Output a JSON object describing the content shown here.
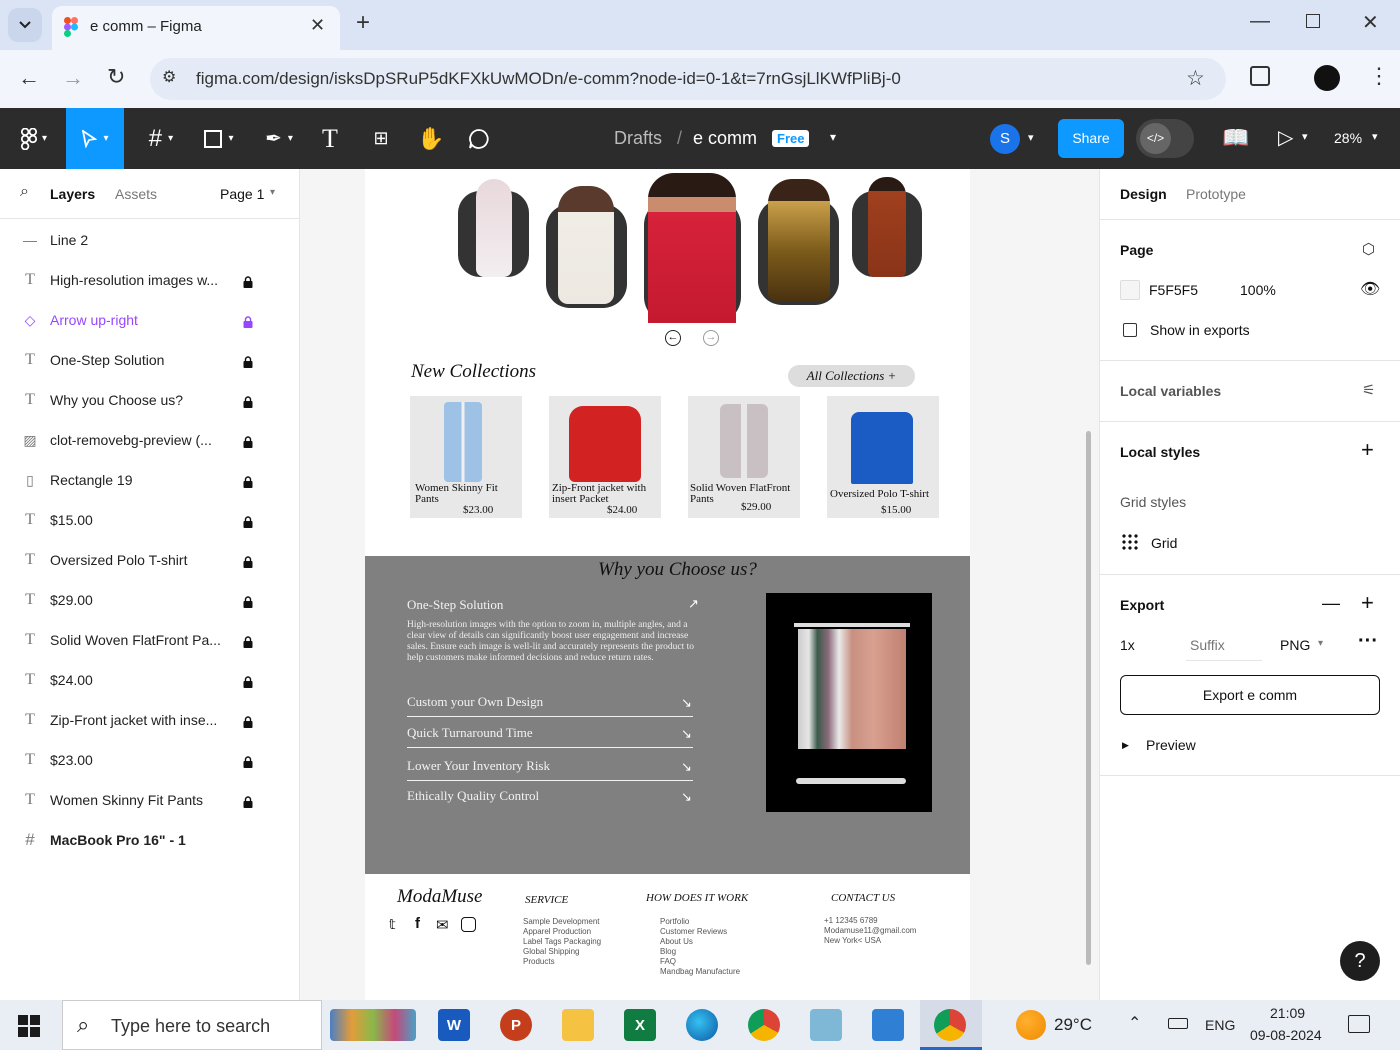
{
  "browser": {
    "tab_title": "e comm – Figma",
    "url": "figma.com/design/isksDpSRuP5dKFXkUwMODn/e-comm?node-id=0-1&t=7rnGsjLlKWfPliBj-0"
  },
  "figma_toolbar": {
    "breadcrumb_drafts": "Drafts",
    "breadcrumb_sep": "/",
    "file_name": "e comm",
    "plan_badge": "Free",
    "user_initial": "S",
    "share_label": "Share",
    "zoom": "28%"
  },
  "left_panel": {
    "tab_layers": "Layers",
    "tab_assets": "Assets",
    "page_selector": "Page 1",
    "layers": [
      {
        "name": "Line 2",
        "icon": "line-icon",
        "locked": false
      },
      {
        "name": "High-resolution images w...",
        "icon": "text-icon",
        "locked": true
      },
      {
        "name": "Arrow up-right",
        "icon": "component-icon",
        "locked": true,
        "highlight": true
      },
      {
        "name": "One-Step Solution",
        "icon": "text-icon",
        "locked": true
      },
      {
        "name": "Why you Choose us?",
        "icon": "text-icon",
        "locked": true
      },
      {
        "name": "clot-removebg-preview (...",
        "icon": "image-icon",
        "locked": true
      },
      {
        "name": "Rectangle 19",
        "icon": "rectangle-icon",
        "locked": true
      },
      {
        "name": "$15.00",
        "icon": "text-icon",
        "locked": true
      },
      {
        "name": "Oversized Polo T-shirt",
        "icon": "text-icon",
        "locked": true
      },
      {
        "name": "$29.00",
        "icon": "text-icon",
        "locked": true
      },
      {
        "name": "Solid Woven FlatFront Pa...",
        "icon": "text-icon",
        "locked": true
      },
      {
        "name": "$24.00",
        "icon": "text-icon",
        "locked": true
      },
      {
        "name": "Zip-Front jacket with inse...",
        "icon": "text-icon",
        "locked": true
      },
      {
        "name": "$23.00",
        "icon": "text-icon",
        "locked": true
      },
      {
        "name": "Women Skinny Fit Pants",
        "icon": "text-icon",
        "locked": true
      },
      {
        "name": "MacBook Pro 16\" - 1",
        "icon": "frame-icon",
        "locked": false,
        "bold": true
      }
    ]
  },
  "design": {
    "new_collections_title": "New Collections",
    "all_collections_btn": "All Collections +",
    "products": [
      {
        "name": "Women Skinny Fit Pants",
        "price": "$23.00"
      },
      {
        "name": "Zip-Front jacket with insert Packet",
        "price": "$24.00"
      },
      {
        "name": "Solid Woven FlatFront Pants",
        "price": "$29.00"
      },
      {
        "name": "Oversized Polo T-shirt",
        "price": "$15.00"
      }
    ],
    "why_title": "Why you Choose us?",
    "one_step_title": "One-Step Solution",
    "one_step_body": "High-resolution images with the option to zoom in, multiple angles, and a clear view of details can significantly boost user engagement and increase sales. Ensure each image is well-lit and accurately represents the product to help customers make informed decisions and reduce return rates.",
    "accordion": [
      "Custom your Own Design",
      "Quick Turnaround Time",
      "Lower Your Inventory Risk",
      "Ethically Quality Control"
    ],
    "footer": {
      "brand": "ModaMuse",
      "col1_title": "SERVICE",
      "col1_items": [
        "Sample Development",
        "Apparel Production",
        "Label Tags Packaging",
        "Global Shipping",
        "Products"
      ],
      "col2_title": "HOW DOES IT WORK",
      "col2_items": [
        "Portfolio",
        "Customer Reviews",
        "About Us",
        "Blog",
        "FAQ",
        "Mandbag Manufacture"
      ],
      "col3_title": "CONTACT US",
      "col3_items": [
        "+1 12345 6789",
        "Modamuse11@gmail.com",
        "New York< USA"
      ]
    }
  },
  "right_panel": {
    "tab_design": "Design",
    "tab_prototype": "Prototype",
    "page_label": "Page",
    "page_color": "F5F5F5",
    "page_opacity": "100%",
    "show_in_exports": "Show in exports",
    "local_variables": "Local variables",
    "local_styles": "Local styles",
    "grid_styles": "Grid styles",
    "grid_name": "Grid",
    "export_label": "Export",
    "export_scale": "1x",
    "export_suffix_placeholder": "Suffix",
    "export_format": "PNG",
    "export_button": "Export e comm",
    "preview_label": "Preview"
  },
  "taskbar": {
    "search_placeholder": "Type here to search",
    "weather": "29°C",
    "language": "ENG",
    "time": "21:09",
    "date": "09-08-2024"
  },
  "colors": {
    "figma_dark": "#2c2c2c",
    "figma_blue": "#0d99ff",
    "purple": "#9747ff",
    "section_grey": "#808080"
  }
}
